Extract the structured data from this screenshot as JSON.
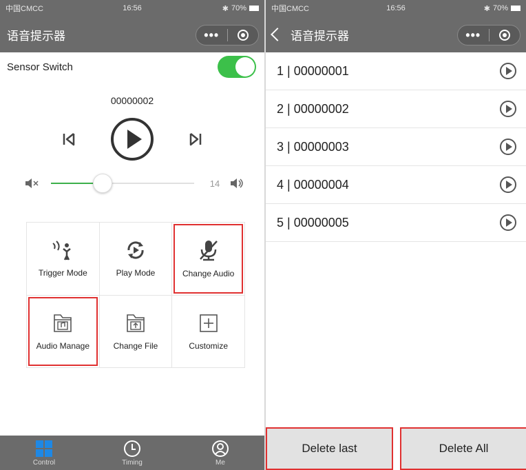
{
  "left": {
    "status": {
      "carrier": "中国CMCC",
      "time": "16:56",
      "battery": "70%"
    },
    "title": "语音提示器",
    "sensor_label": "Sensor Switch",
    "sensor_on": true,
    "track_name": "00000002",
    "volume": {
      "value": "14",
      "level_fraction": 0.36
    },
    "grid": [
      {
        "label": "Trigger Mode",
        "icon": "trigger-icon",
        "highlighted": false
      },
      {
        "label": "Play Mode",
        "icon": "play-mode-icon",
        "highlighted": false
      },
      {
        "label": "Change Audio",
        "icon": "mic-off-icon",
        "highlighted": true
      },
      {
        "label": "Audio Manage",
        "icon": "music-folder-icon",
        "highlighted": true
      },
      {
        "label": "Change File",
        "icon": "upload-folder-icon",
        "highlighted": false
      },
      {
        "label": "Customize",
        "icon": "plus-box-icon",
        "highlighted": false
      }
    ],
    "tabs": [
      {
        "label": "Control",
        "icon": "grid-icon",
        "active": true
      },
      {
        "label": "Timing",
        "icon": "clock-icon",
        "active": false
      },
      {
        "label": "Me",
        "icon": "user-icon",
        "active": false
      }
    ]
  },
  "right": {
    "status": {
      "carrier": "中国CMCC",
      "time": "16:56",
      "battery": "70%"
    },
    "title": "语音提示器",
    "items": [
      {
        "text": "1 | 00000001"
      },
      {
        "text": "2 | 00000002"
      },
      {
        "text": "3 | 00000003"
      },
      {
        "text": "4 | 00000004"
      },
      {
        "text": "5 | 00000005"
      }
    ],
    "delete_last_label": "Delete last",
    "delete_all_label": "Delete All"
  },
  "colors": {
    "accent_green": "#3cc04a",
    "bar_gray": "#6b6b6b",
    "highlight_red": "#e03030",
    "tab_active": "#1e88e5"
  }
}
